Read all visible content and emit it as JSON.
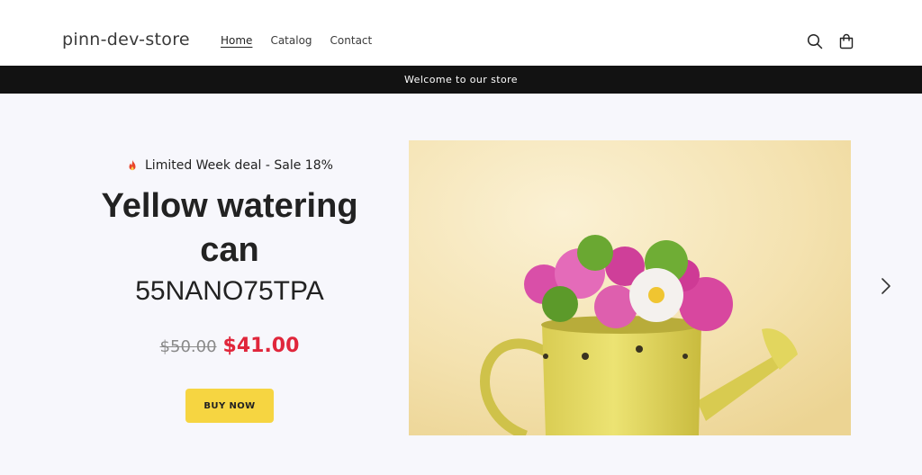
{
  "header": {
    "logo": "pinn-dev-store",
    "nav": [
      {
        "label": "Home",
        "active": true
      },
      {
        "label": "Catalog",
        "active": false
      },
      {
        "label": "Contact",
        "active": false
      }
    ],
    "icons": [
      "search-icon",
      "cart-icon"
    ]
  },
  "announcement": {
    "text": "Welcome to our store"
  },
  "hero": {
    "deal_text": "Limited Week deal - Sale 18%",
    "deal_icon": "fire-icon",
    "title": "Yellow watering can",
    "sku": "55NANO75TPA",
    "old_price": "$50.00",
    "new_price": "$41.00",
    "buy_label": "BUY NOW",
    "image_alt": "Yellow watering can with pink and white flowers",
    "next_icon": "chevron-right-icon"
  },
  "colors": {
    "accent_button": "#f6d541",
    "sale_price": "#e0263b",
    "announcement_bg": "#121212",
    "page_bg": "#f7f7fc"
  }
}
